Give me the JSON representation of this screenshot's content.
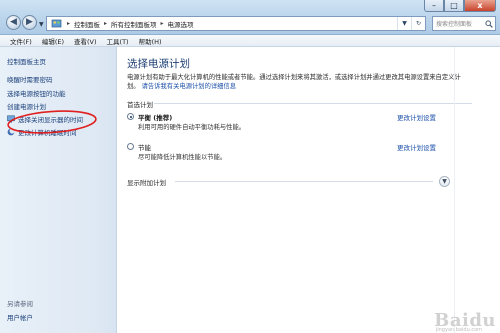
{
  "window": {
    "minimize_glyph": "–",
    "maximize_glyph": "□",
    "close_glyph": "x"
  },
  "address_bar": {
    "crumbs": [
      "控制面板",
      "所有控制面板项",
      "电源选项"
    ],
    "separator": "▸"
  },
  "search": {
    "placeholder": "搜索控制面板"
  },
  "menu": [
    "文件(F)",
    "编辑(E)",
    "查看(V)",
    "工具(T)",
    "帮助(H)"
  ],
  "left_pane": {
    "home": "控制面板主页",
    "links": [
      "唤醒时需要密码",
      "选择电源按钮的功能",
      "创建电源计划",
      "选择关闭显示器的时间",
      "更改计算机睡眠时间"
    ],
    "see_also": "另请参阅",
    "user_accounts": "用户帐户"
  },
  "main": {
    "title": "选择电源计划",
    "description": "电源计划有助于最大化计算机的性能或者节能。通过选择计划来将其激活，或选择计划并通过更改其电源设置来自定义计划。",
    "description_link": "请告诉我有关电源计划的详细信息",
    "preferred_section": "首选计划",
    "plans": [
      {
        "name": "平衡 (推荐)",
        "desc": "利用可用的硬件自动平衡功耗与性能。",
        "change": "更改计划设置",
        "selected": true
      },
      {
        "name": "节能",
        "desc": "尽可能降低计算机性能以节能。",
        "change": "更改计划设置",
        "selected": false
      }
    ],
    "show_more": "显示附加计划"
  },
  "watermark": {
    "brand": "Baidu",
    "url": "jingyan.baidu.com"
  },
  "colors": {
    "annotation_red": "#e02020",
    "link_blue": "#1a4fa8"
  }
}
